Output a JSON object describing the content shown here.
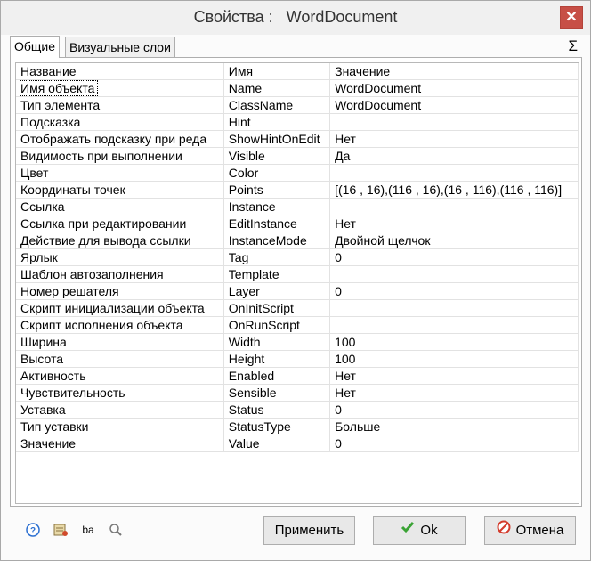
{
  "window": {
    "title": "Свойства :   WordDocument"
  },
  "tabs": [
    {
      "label": "Общие"
    },
    {
      "label": "Визуальные слои"
    }
  ],
  "sigma_label": "Σ",
  "table": {
    "headers": [
      "Название",
      "Имя",
      "Значение"
    ],
    "rows": [
      [
        "Имя объекта",
        "Name",
        "WordDocument"
      ],
      [
        "Тип элемента",
        "ClassName",
        "WordDocument"
      ],
      [
        "Подсказка",
        "Hint",
        ""
      ],
      [
        "Отображать подсказку при реда",
        "ShowHintOnEdit",
        "Нет"
      ],
      [
        "Видимость при выполнении",
        "Visible",
        "Да"
      ],
      [
        "Цвет",
        "Color",
        ""
      ],
      [
        "Координаты точек",
        "Points",
        "[(16 , 16),(116 , 16),(16 , 116),(116 , 116)]"
      ],
      [
        "Ссылка",
        "Instance",
        ""
      ],
      [
        "Ссылка при редактировании",
        "EditInstance",
        "Нет"
      ],
      [
        "Действие для вывода ссылки",
        "InstanceMode",
        "Двойной щелчок"
      ],
      [
        "Ярлык",
        "Tag",
        "0"
      ],
      [
        "Шаблон автозаполнения",
        "Template",
        ""
      ],
      [
        "Номер решателя",
        "Layer",
        "0"
      ],
      [
        "Скрипт инициализации объекта",
        "OnInitScript",
        ""
      ],
      [
        "Скрипт исполнения объекта",
        "OnRunScript",
        ""
      ],
      [
        "Ширина",
        "Width",
        "100"
      ],
      [
        "Высота",
        "Height",
        "100"
      ],
      [
        "Активность",
        "Enabled",
        "Нет"
      ],
      [
        "Чувствительность",
        "Sensible",
        "Нет"
      ],
      [
        "Уставка",
        "Status",
        "0"
      ],
      [
        "Тип уставки",
        "StatusType",
        "Больше"
      ],
      [
        "Значение",
        "Value",
        "0"
      ]
    ]
  },
  "footer": {
    "icons": [
      "help-icon",
      "properties-icon",
      "rename-icon",
      "search-icon"
    ],
    "rename_glyph": "ba",
    "help_glyph": "?",
    "apply_label": "Применить",
    "ok_label": "Ok",
    "cancel_label": "Отмена"
  },
  "colors": {
    "close": "#c74f46",
    "ok_check": "#3aa335",
    "cancel_icon": "#d33b2c",
    "help_blue": "#2b6fd1"
  }
}
